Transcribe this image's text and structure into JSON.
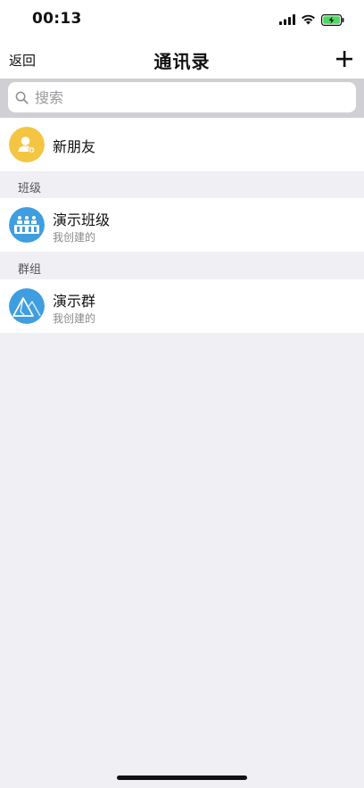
{
  "status_bar": {
    "time": "00:13"
  },
  "nav": {
    "back_label": "返回",
    "title": "通讯录",
    "add_icon": "plus-icon"
  },
  "search": {
    "placeholder": "搜索",
    "value": ""
  },
  "new_friends": {
    "label": "新朋友",
    "icon": "add-contact-icon",
    "color": "#f4c542"
  },
  "sections": [
    {
      "header": "班级",
      "items": [
        {
          "title": "演示班级",
          "subtitle": "我创建的",
          "icon": "class-icon",
          "color": "#3f9ee0"
        }
      ]
    },
    {
      "header": "群组",
      "items": [
        {
          "title": "演示群",
          "subtitle": "我创建的",
          "icon": "mountain-group-icon",
          "color": "#3f9ee0"
        }
      ]
    }
  ],
  "colors": {
    "background": "#efeff4",
    "search_bar": "#d0d0d4",
    "avatar_yellow": "#f4c542",
    "avatar_blue": "#3f9ee0"
  }
}
